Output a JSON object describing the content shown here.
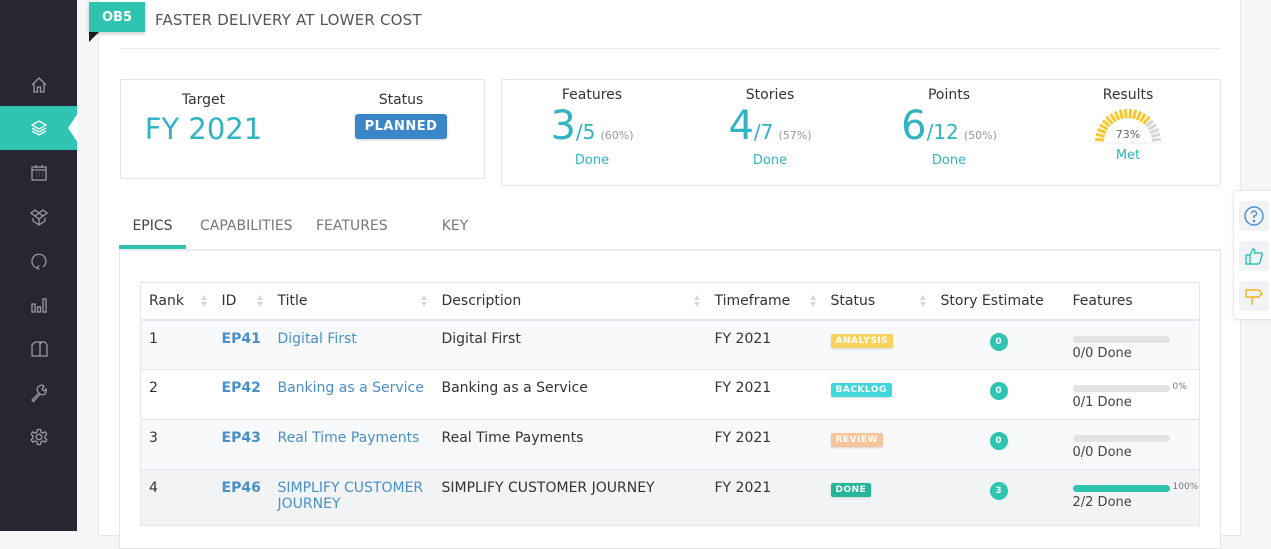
{
  "sidebar": {
    "items": [
      {
        "name": "home",
        "icon": "home-icon",
        "active": false
      },
      {
        "name": "layers",
        "icon": "layers-icon",
        "active": true
      },
      {
        "name": "calendar",
        "icon": "calendar-icon",
        "active": false
      },
      {
        "name": "dropbox",
        "icon": "boxes-icon",
        "active": false
      },
      {
        "name": "refresh",
        "icon": "refresh-icon",
        "active": false
      },
      {
        "name": "reports",
        "icon": "bar-chart-icon",
        "active": false
      },
      {
        "name": "documents",
        "icon": "documents-icon",
        "active": false
      },
      {
        "name": "tools",
        "icon": "wrench-icon",
        "active": false
      },
      {
        "name": "settings",
        "icon": "gear-icon",
        "active": false
      }
    ]
  },
  "objective": {
    "tag": "OB5",
    "title": "FASTER DELIVERY AT LOWER COST"
  },
  "summary": {
    "target_label": "Target",
    "target_value": "FY 2021",
    "status_label": "Status",
    "status_value": "PLANNED"
  },
  "metrics": {
    "features": {
      "label": "Features",
      "done": "3",
      "total": "/5",
      "pct": "(60%)",
      "foot": "Done"
    },
    "stories": {
      "label": "Stories",
      "done": "4",
      "total": "/7",
      "pct": "(57%)",
      "foot": "Done"
    },
    "points": {
      "label": "Points",
      "done": "6",
      "total": "/12",
      "pct": "(50%)",
      "foot": "Done"
    },
    "results": {
      "label": "Results",
      "gauge_percent": 73,
      "gauge_text": "73%",
      "foot": "Met"
    }
  },
  "tabs": [
    {
      "label": "EPICS",
      "active": true
    },
    {
      "label": "CAPABILITIES",
      "active": false
    },
    {
      "label": "FEATURES",
      "active": false
    },
    {
      "label": "KEY RESULTS",
      "active": false
    }
  ],
  "table": {
    "columns": [
      "Rank",
      "ID",
      "Title",
      "Description",
      "Timeframe",
      "Status",
      "Story Estimate",
      "Features"
    ],
    "rows": [
      {
        "rank": "1",
        "id": "EP41",
        "title": "Digital First",
        "description": "Digital First",
        "timeframe": "FY 2021",
        "status": "ANALYSIS",
        "status_color": "#f9d35b",
        "estimate": "0",
        "progress": 0,
        "progress_label": "",
        "features_done": "0/0 Done"
      },
      {
        "rank": "2",
        "id": "EP42",
        "title": "Banking as a Service",
        "description": "Banking as a Service",
        "timeframe": "FY 2021",
        "status": "BACKLOG",
        "status_color": "#3fd6dc",
        "estimate": "0",
        "progress": 0,
        "progress_label": "0%",
        "features_done": "0/1 Done"
      },
      {
        "rank": "3",
        "id": "EP43",
        "title": "Real Time Payments",
        "description": "Real Time Payments",
        "timeframe": "FY 2021",
        "status": "REVIEW",
        "status_color": "#f7c59a",
        "estimate": "0",
        "progress": 0,
        "progress_label": "",
        "features_done": "0/0 Done"
      },
      {
        "rank": "4",
        "id": "EP46",
        "title": "SIMPLIFY CUSTOMER JOURNEY",
        "description": "SIMPLIFY CUSTOMER JOURNEY",
        "timeframe": "FY 2021",
        "status": "DONE",
        "status_color": "#27b59a",
        "estimate": "3",
        "progress": 100,
        "progress_label": "100%",
        "features_done": "2/2 Done"
      }
    ]
  },
  "float_panel": [
    {
      "icon": "help-icon",
      "color": "#4a8fd0"
    },
    {
      "icon": "thumbs-up-icon",
      "color": "#2ec4b0"
    },
    {
      "icon": "signpost-icon",
      "color": "#f5b51c"
    }
  ],
  "colors": {
    "accent": "#2ec4b0",
    "link": "#4a90c8",
    "metric": "#31b3c2",
    "planned": "#3b86c9",
    "gauge": "#f6c729"
  }
}
